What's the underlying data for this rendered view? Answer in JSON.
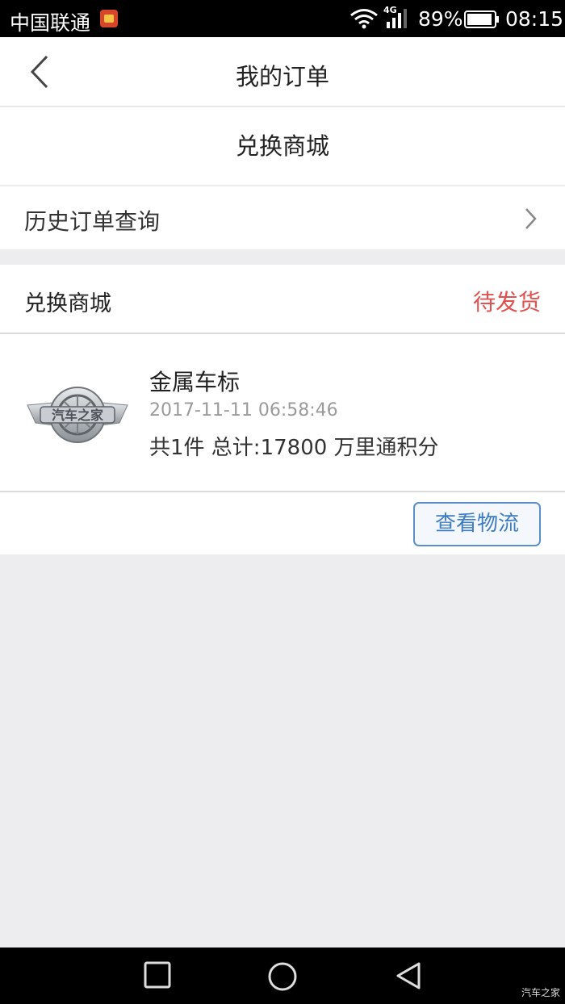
{
  "status_bar": {
    "carrier": "中国联通",
    "network": "4G",
    "battery_percent": "89%",
    "time": "08:15",
    "icons": [
      "notification-app-icon",
      "wifi-icon",
      "signal-icon",
      "battery-icon"
    ]
  },
  "header": {
    "title": "我的订单",
    "back_icon": "chevron-left-icon"
  },
  "section": {
    "title": "兑换商城"
  },
  "history": {
    "label": "历史订单查询",
    "icon": "chevron-right-icon"
  },
  "order": {
    "shop_name": "兑换商城",
    "status": "待发货",
    "status_color": "#e2504f",
    "product": {
      "name": "金属车标",
      "time": "2017-11-11 06:58:46",
      "summary": "共1件 总计:17800 万里通积分",
      "thumbnail": "car-badge-logo",
      "logo_text": "汽车之家"
    },
    "track_button": "查看物流",
    "accent_color": "#3d7cc4"
  },
  "nav_bar": {
    "buttons": [
      "square-recents-icon",
      "circle-home-icon",
      "triangle-back-icon"
    ],
    "watermark": "汽车之家"
  }
}
